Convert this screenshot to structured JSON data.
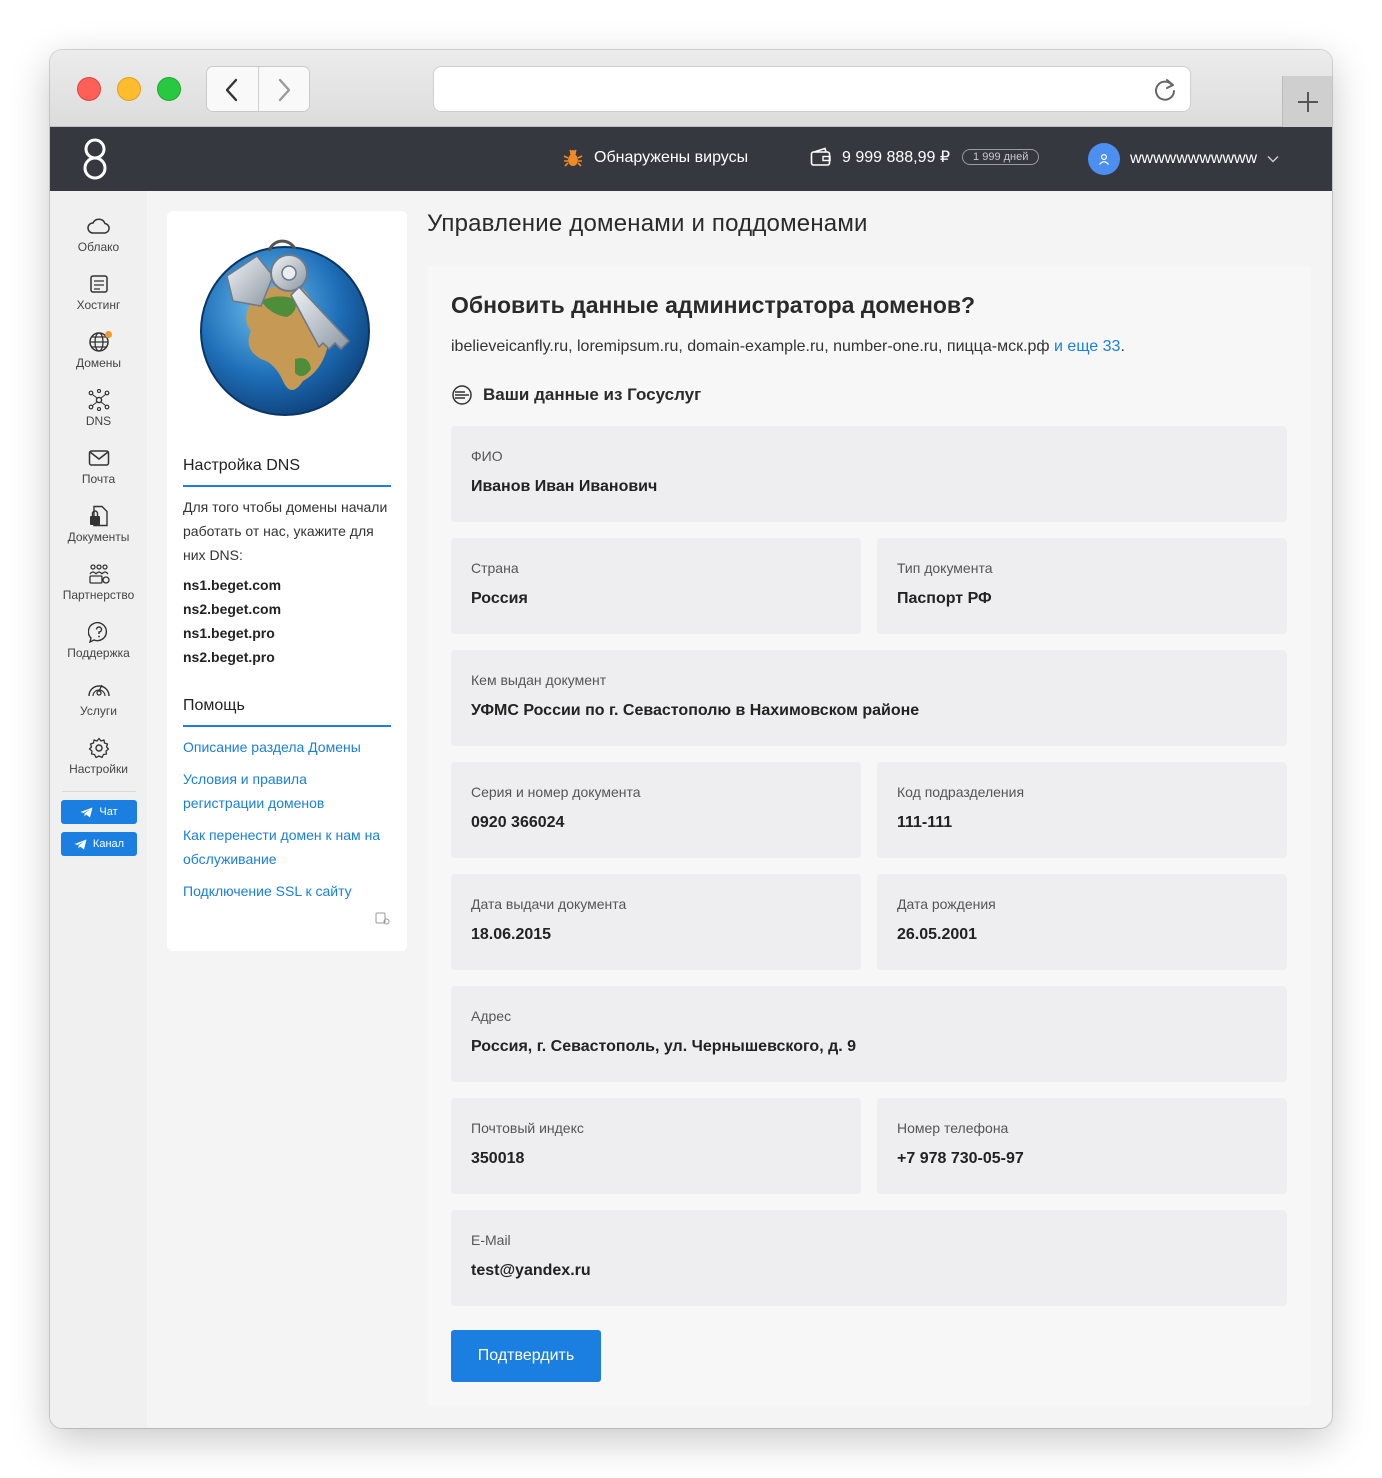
{
  "header": {
    "virus_text": "Обнаружены вирусы",
    "balance": "9 999 888,99 ₽",
    "days": "1 999 дней",
    "username": "wwwwwwwwwww"
  },
  "nav": {
    "items": [
      {
        "label": "Облако",
        "icon": "cloud-icon"
      },
      {
        "label": "Хостинг",
        "icon": "server-icon"
      },
      {
        "label": "Домены",
        "icon": "globe-icon"
      },
      {
        "label": "DNS",
        "icon": "network-icon"
      },
      {
        "label": "Почта",
        "icon": "mail-icon"
      },
      {
        "label": "Документы",
        "icon": "document-icon"
      },
      {
        "label": "Партнерство",
        "icon": "partners-icon"
      },
      {
        "label": "Поддержка",
        "icon": "support-icon"
      },
      {
        "label": "Услуги",
        "icon": "services-icon"
      },
      {
        "label": "Настройки",
        "icon": "gear-icon"
      }
    ],
    "chat_label": "Чат",
    "channel_label": "Канал"
  },
  "side": {
    "dns_title": "Настройка DNS",
    "dns_text": "Для того чтобы домены начали работать от нас, укажите для них DNS:",
    "ns": [
      "ns1.beget.com",
      "ns2.beget.com",
      "ns1.beget.pro",
      "ns2.beget.pro"
    ],
    "help_title": "Помощь",
    "links": [
      "Описание раздела Домены",
      "Условия и правила регистрации доменов",
      "Как перенести домен к нам на обслуживание",
      "Подключение SSL к сайту"
    ]
  },
  "main": {
    "page_title": "Управление доменами и поддоменами",
    "card_title": "Обновить данные администратора доменов?",
    "domains_list": "ibelieveicanfly.ru, loremipsum.ru, domain-example.ru, number-one.ru, пицца-мск.рф",
    "domains_more": "и еще 33",
    "gos_title": "Ваши данные из Госуслуг",
    "fields": {
      "fio": {
        "label": "ФИО",
        "value": "Иванов Иван Иванович"
      },
      "country": {
        "label": "Страна",
        "value": "Россия"
      },
      "doctype": {
        "label": "Тип документа",
        "value": "Паспорт РФ"
      },
      "issuer": {
        "label": "Кем выдан документ",
        "value": "УФМС России по г. Севастополю в Нахимовском районе"
      },
      "series": {
        "label": "Серия и номер документа",
        "value": "0920 366024"
      },
      "code": {
        "label": "Код подразделения",
        "value": "111-111"
      },
      "issue_date": {
        "label": "Дата выдачи документа",
        "value": "18.06.2015"
      },
      "birth": {
        "label": "Дата рождения",
        "value": "26.05.2001"
      },
      "address": {
        "label": "Адрес",
        "value": "Россия, г. Севастополь, ул. Чернышевского, д. 9"
      },
      "zip": {
        "label": "Почтовый индекс",
        "value": "350018"
      },
      "phone": {
        "label": "Номер телефона",
        "value": "+7 978 730-05-97"
      },
      "email": {
        "label": "E-Mail",
        "value": "test@yandex.ru"
      }
    },
    "confirm_label": "Подтвердить"
  }
}
